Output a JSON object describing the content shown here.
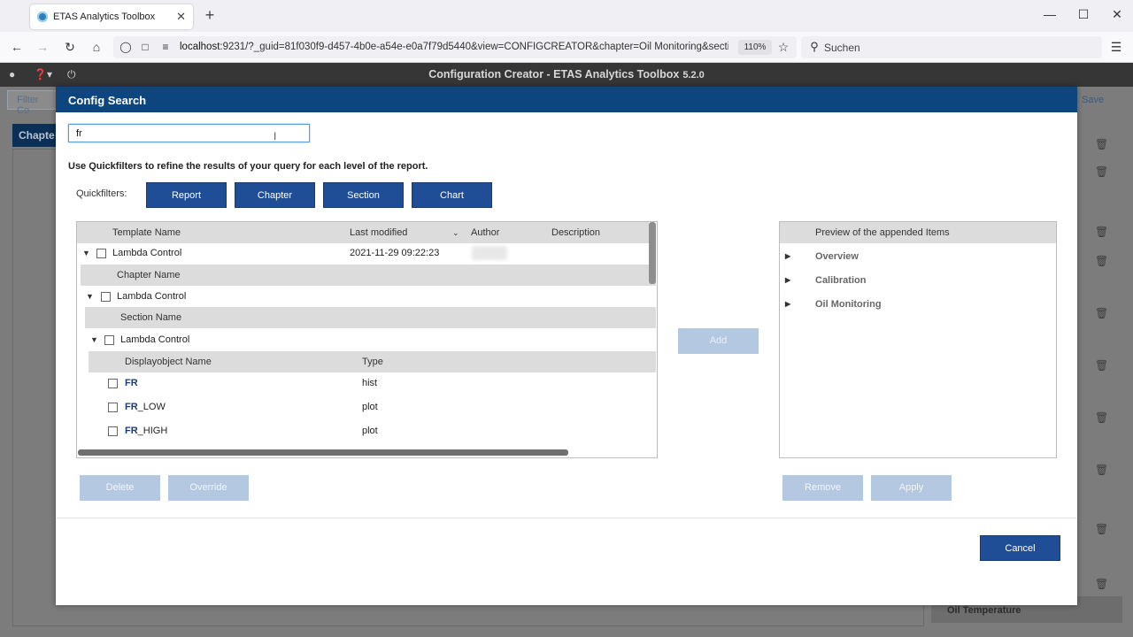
{
  "browser": {
    "tab_title": "ETAS Analytics Toolbox",
    "tab_close": "✕",
    "new_tab": "+",
    "url_host": "localhost",
    "url_rest": ":9231/?_guid=81f030f9-d457-4b0e-a54e-e0a7f79d5440&view=CONFIGCREATOR&chapter=Oil Monitoring&secti",
    "zoom": "110%",
    "search_placeholder": "Suchen"
  },
  "app": {
    "title": "Configuration Creator -   ETAS Analytics Toolbox",
    "version": "5.2.0",
    "bg_filter": "Filter Co",
    "bg_save": "Save",
    "bg_chapter": "Chapte",
    "bg_oil": "Oil Temperature"
  },
  "modal": {
    "title": "Config Search",
    "search_value": "fr",
    "hint": "Use Quickfilters to refine the results of your query for each level of the report.",
    "quickfilters_label": "Quickfilters:",
    "quickfilters": [
      "Report",
      "Chapter",
      "Section",
      "Chart"
    ],
    "table": {
      "headers": {
        "template_name": "Template Name",
        "last_modified": "Last modified",
        "author": "Author",
        "description": "Description"
      },
      "template": {
        "name": "Lambda Control",
        "modified": "2021-11-29 09:22:23"
      },
      "chapter_header": "Chapter Name",
      "chapter": "Lambda Control",
      "section_header": "Section Name",
      "section": "Lambda Control",
      "display_header": "Displayobject Name",
      "type_header": "Type",
      "objects": [
        {
          "match": "FR",
          "rest": "",
          "type": "hist"
        },
        {
          "match": "FR",
          "rest": "_LOW",
          "type": "plot"
        },
        {
          "match": "FR",
          "rest": "_HIGH",
          "type": "plot"
        }
      ]
    },
    "add_label": "Add",
    "preview_header": "Preview of the appended Items",
    "preview_items": [
      "Overview",
      "Calibration",
      "Oil Monitoring"
    ],
    "buttons": {
      "delete": "Delete",
      "override": "Override",
      "remove": "Remove",
      "apply": "Apply",
      "cancel": "Cancel"
    }
  },
  "colors": {
    "primary": "#1f4e96",
    "header": "#0d467f",
    "disabled": "#b4c8e2"
  }
}
